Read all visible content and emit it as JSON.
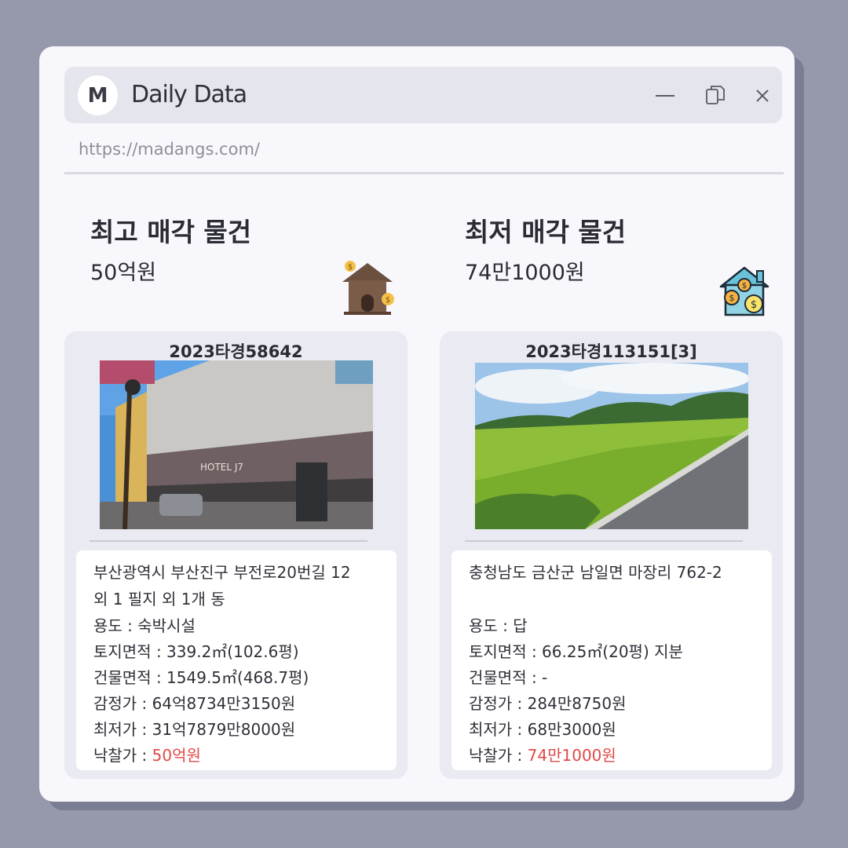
{
  "app": {
    "logo_letter": "M",
    "title": "Daily Data",
    "url": "https://madangs.com/"
  },
  "window_controls": {
    "minimize_icon": "minimize-icon",
    "copy_icon": "copy-icon",
    "close_icon": "close-icon"
  },
  "highest": {
    "heading": "최고 매각 물건",
    "price": "50억원",
    "icon": "house-money-icon",
    "case_no": "2023타경58642",
    "photo": "hotel-building-photo",
    "address_line1": "부산광역시 부산진구 부전로20번길 12",
    "address_line2": "외 1 필지 외 1개 동",
    "usage": "용도 : 숙박시설",
    "land_area": "토지면적 : 339.2㎡(102.6평)",
    "building_area": "건물면적 : 1549.5㎡(468.7평)",
    "appraisal": "감정가 : 64억8734만3150원",
    "minimum": "최저가 : 31억7879만8000원",
    "winning_label": "낙찰가 : ",
    "winning_value": "50억원"
  },
  "lowest": {
    "heading": "최저 매각 물건",
    "price": "74만1000원",
    "icon": "house-coins-icon",
    "case_no": "2023타경113151[3]",
    "photo": "rice-field-photo",
    "address_line1": "충청남도 금산군 남일면 마장리 762-2",
    "address_line2": "",
    "usage": "용도 :  답",
    "land_area": "토지면적 : 66.25㎡(20평) 지분",
    "building_area": "건물면적 : -",
    "appraisal": "감정가 : 284만8750원",
    "minimum": "최저가 : 68만3000원",
    "winning_label": "낙찰가 : ",
    "winning_value": "74만1000원"
  },
  "colors": {
    "background": "#9698ab",
    "window": "#f7f7fc",
    "card": "#e9eaf2",
    "highlight": "#e24848"
  }
}
